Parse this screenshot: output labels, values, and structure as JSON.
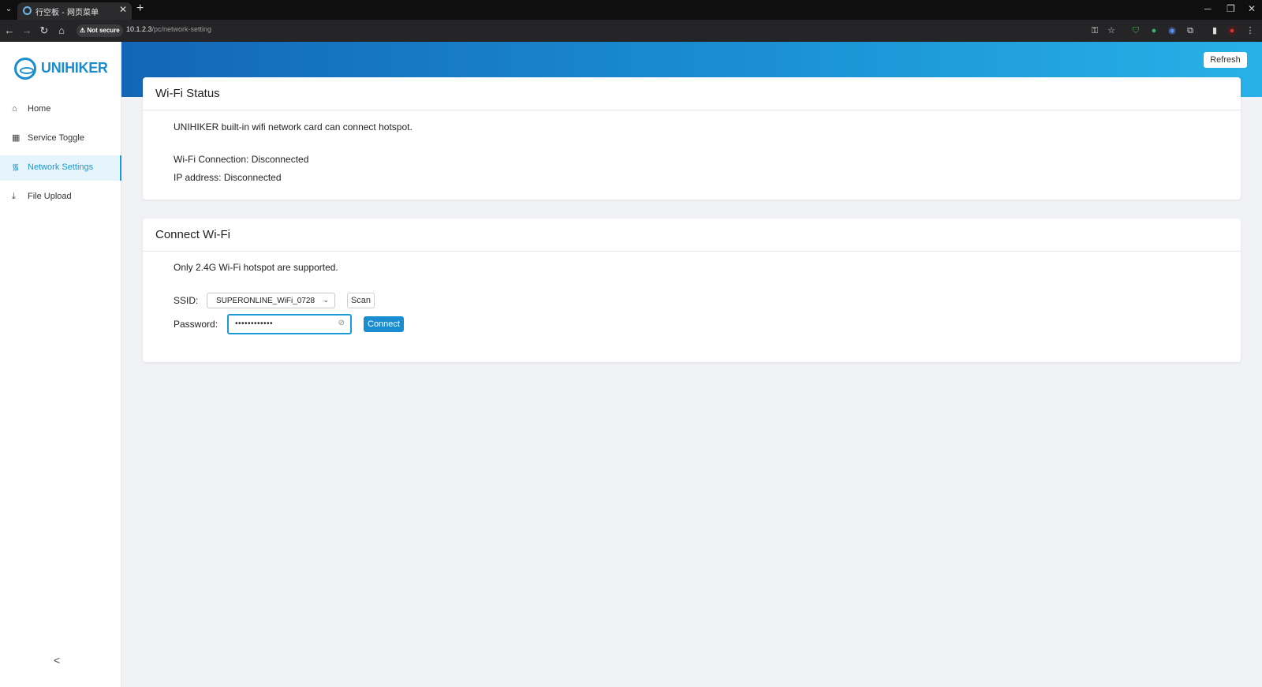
{
  "browser": {
    "tab_title": "行空板 - 网页菜单",
    "tab_close": "✕",
    "new_tab": "+",
    "security_label": "Not secure",
    "url_host": "10.1.2.3",
    "url_path": "/pc/network-setting"
  },
  "sidebar": {
    "brand": "UNIHIKER",
    "items": [
      {
        "label": "Home",
        "icon": "home-icon"
      },
      {
        "label": "Service Toggle",
        "icon": "grid-icon"
      },
      {
        "label": "Network Settings",
        "icon": "wifi-icon",
        "active": true
      },
      {
        "label": "File Upload",
        "icon": "upload-icon"
      }
    ],
    "collapse_glyph": "<"
  },
  "header": {
    "refresh_label": "Refresh"
  },
  "wifi_status": {
    "title": "Wi-Fi Status",
    "description": "UNIHIKER built-in wifi network card can connect hotspot.",
    "connection": "Wi-Fi Connection: Disconnected",
    "ip": "IP address: Disconnected"
  },
  "connect_wifi": {
    "title": "Connect Wi-Fi",
    "note": "Only 2.4G Wi-Fi hotspot are supported.",
    "ssid_label": "SSID:",
    "ssid_value": "SUPERONLINE_WiFi_0728",
    "scan_label": "Scan",
    "password_label": "Password:",
    "password_value": "••••••••••••",
    "connect_label": "Connect"
  },
  "colors": {
    "accent": "#1a8dd1",
    "active_bg": "#e6f4fb"
  }
}
